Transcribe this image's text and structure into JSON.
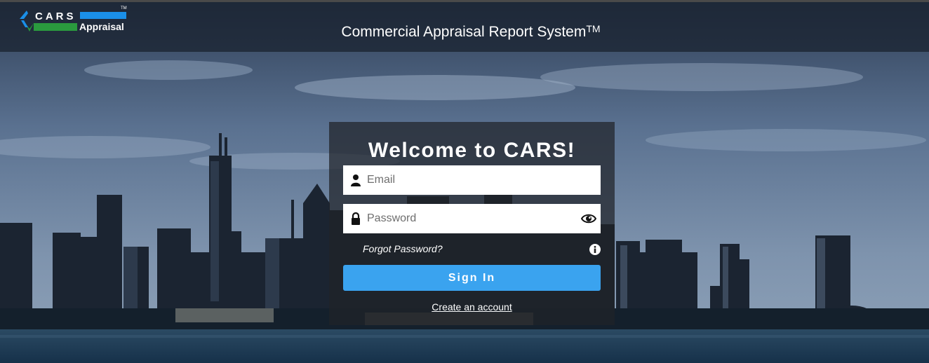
{
  "header": {
    "logo": {
      "name": "CARS",
      "sub": "Appraisal",
      "tm": "TM"
    },
    "title": "Commercial Appraisal Report System",
    "title_tm": "TM"
  },
  "login": {
    "heading": "Welcome to CARS!",
    "email": {
      "value": "",
      "placeholder": "Email"
    },
    "password": {
      "value": "",
      "placeholder": "Password"
    },
    "forgot_label": "Forgot Password?",
    "signin_label": "Sign In",
    "create_label": "Create an account"
  },
  "icons": {
    "email": "user-icon",
    "password": "lock-icon",
    "toggle": "eye-icon",
    "info": "info-icon"
  },
  "colors": {
    "accent": "#3aa3ef",
    "logo_blue": "#1a8fe8",
    "logo_green": "#2a9a3e",
    "header_bg": "#18202c",
    "card_bg": "#202228"
  }
}
